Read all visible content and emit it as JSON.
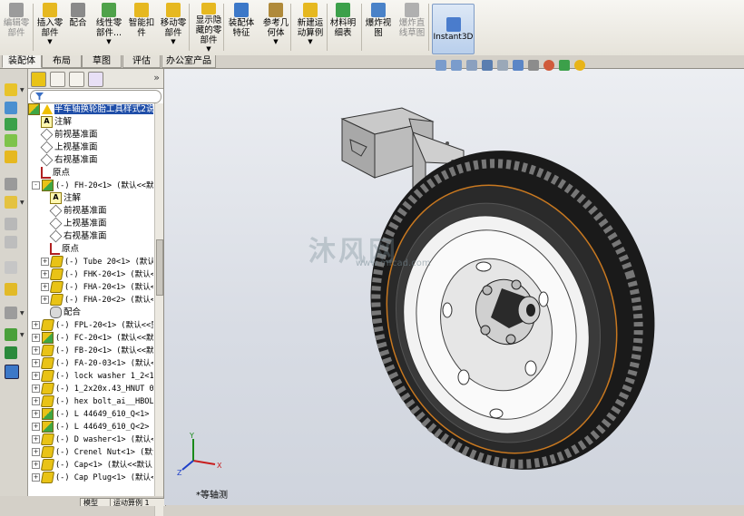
{
  "toolbar": {
    "buttons": [
      {
        "label": "编辑零\n部件",
        "icon": "edit-component-icon",
        "enabled": false
      },
      {
        "label": "插入零\n部件",
        "icon": "insert-component-icon",
        "enabled": true
      },
      {
        "label": "配合",
        "icon": "mate-icon",
        "enabled": true
      },
      {
        "label": "线性零\n部件...",
        "icon": "linear-pattern-icon",
        "enabled": true
      },
      {
        "label": "智能扣\n件",
        "icon": "smart-fasteners-icon",
        "enabled": true
      },
      {
        "label": "移动零\n部件",
        "icon": "move-component-icon",
        "enabled": true
      },
      {
        "label": "显示隐\n藏的零\n部件",
        "icon": "show-hidden-icon",
        "enabled": true
      },
      {
        "label": "装配体\n特征",
        "icon": "assembly-features-icon",
        "enabled": true
      },
      {
        "label": "参考几\n何体",
        "icon": "reference-geometry-icon",
        "enabled": true
      },
      {
        "label": "新建运\n动算例",
        "icon": "new-motion-study-icon",
        "enabled": true
      },
      {
        "label": "材料明\n细表",
        "icon": "bill-of-materials-icon",
        "enabled": true
      },
      {
        "label": "爆炸视\n图",
        "icon": "exploded-view-icon",
        "enabled": true
      },
      {
        "label": "爆炸直\n线草图",
        "icon": "explode-line-sketch-icon",
        "enabled": false
      }
    ],
    "instant3d": "Instant3D"
  },
  "tabs": [
    "装配体",
    "布局",
    "草图",
    "评估",
    "办公室产品"
  ],
  "active_tab": "装配体",
  "feature_tree": {
    "root": "半车轴换轮胎工具样式2说",
    "items": [
      {
        "text": "注解",
        "indent": 1,
        "icon": "annotation"
      },
      {
        "text": "前视基准面",
        "indent": 1,
        "icon": "plane"
      },
      {
        "text": "上视基准面",
        "indent": 1,
        "icon": "plane"
      },
      {
        "text": "右视基准面",
        "indent": 1,
        "icon": "plane"
      },
      {
        "text": "原点",
        "indent": 1,
        "icon": "origin"
      },
      {
        "text": "(-) FH-20<1> (默认<<默",
        "indent": 0,
        "icon": "asm",
        "exp": "-"
      },
      {
        "text": "注解",
        "indent": 2,
        "icon": "annotation"
      },
      {
        "text": "前视基准面",
        "indent": 2,
        "icon": "plane"
      },
      {
        "text": "上视基准面",
        "indent": 2,
        "icon": "plane"
      },
      {
        "text": "右视基准面",
        "indent": 2,
        "icon": "plane"
      },
      {
        "text": "原点",
        "indent": 2,
        "icon": "origin"
      },
      {
        "text": "(-) Tube 20<1> (默认<",
        "indent": 1,
        "icon": "part",
        "exp": "+"
      },
      {
        "text": "(-) FHK-20<1> (默认<",
        "indent": 1,
        "icon": "part",
        "exp": "+"
      },
      {
        "text": "(-) FHA-20<1> (默认<",
        "indent": 1,
        "icon": "part",
        "exp": "+"
      },
      {
        "text": "(-) FHA-20<2> (默认<",
        "indent": 1,
        "icon": "part",
        "exp": "+"
      },
      {
        "text": "配合",
        "indent": 2,
        "icon": "mate"
      },
      {
        "text": "(-) FPL-20<1> (默认<<里",
        "indent": 0,
        "icon": "part",
        "exp": "+"
      },
      {
        "text": "(-) FC-20<1> (默认<<默",
        "indent": 0,
        "icon": "asm",
        "exp": "+"
      },
      {
        "text": "(-) FB-20<1> (默认<<默",
        "indent": 0,
        "icon": "part",
        "exp": "+"
      },
      {
        "text": "(-) FA-20-03<1> (默认<",
        "indent": 0,
        "icon": "part",
        "exp": "+"
      },
      {
        "text": "(-) lock washer 1_2<1>",
        "indent": 0,
        "icon": "part",
        "exp": "+"
      },
      {
        "text": "(-) 1_2x20x.43_HNUT 0.",
        "indent": 0,
        "icon": "part",
        "exp": "+"
      },
      {
        "text": "(-) hex bolt_ai__HBOLT",
        "indent": 0,
        "icon": "part",
        "exp": "+"
      },
      {
        "text": "(-) L 44649_610_Q<1> (",
        "indent": 0,
        "icon": "asm",
        "exp": "+"
      },
      {
        "text": "(-) L 44649_610_Q<2> (",
        "indent": 0,
        "icon": "asm",
        "exp": "+"
      },
      {
        "text": "(-) D washer<1> (默认<",
        "indent": 0,
        "icon": "part",
        "exp": "+"
      },
      {
        "text": "(-) Crenel Nut<1> (默认",
        "indent": 0,
        "icon": "part",
        "exp": "+"
      },
      {
        "text": "(-) Cap<1> (默认<<默认",
        "indent": 0,
        "icon": "part",
        "exp": "+"
      },
      {
        "text": "(-) Cap Plug<1> (默认<",
        "indent": 0,
        "icon": "part",
        "exp": "+"
      }
    ]
  },
  "bottom_tabs": [
    "模型",
    "运动算例 1"
  ],
  "view": {
    "orientation_label": "*等轴测",
    "triad_axes": [
      "X",
      "Y",
      "Z"
    ],
    "watermark": "沐风网",
    "watermark_sub": "www.mfcad.com"
  },
  "colors": {
    "selection": "#1f4ea8",
    "instant3d_bg": "#c9daf0",
    "x_axis": "#c81e1e",
    "y_axis": "#1a8a1a",
    "z_axis": "#1e3fc8"
  }
}
